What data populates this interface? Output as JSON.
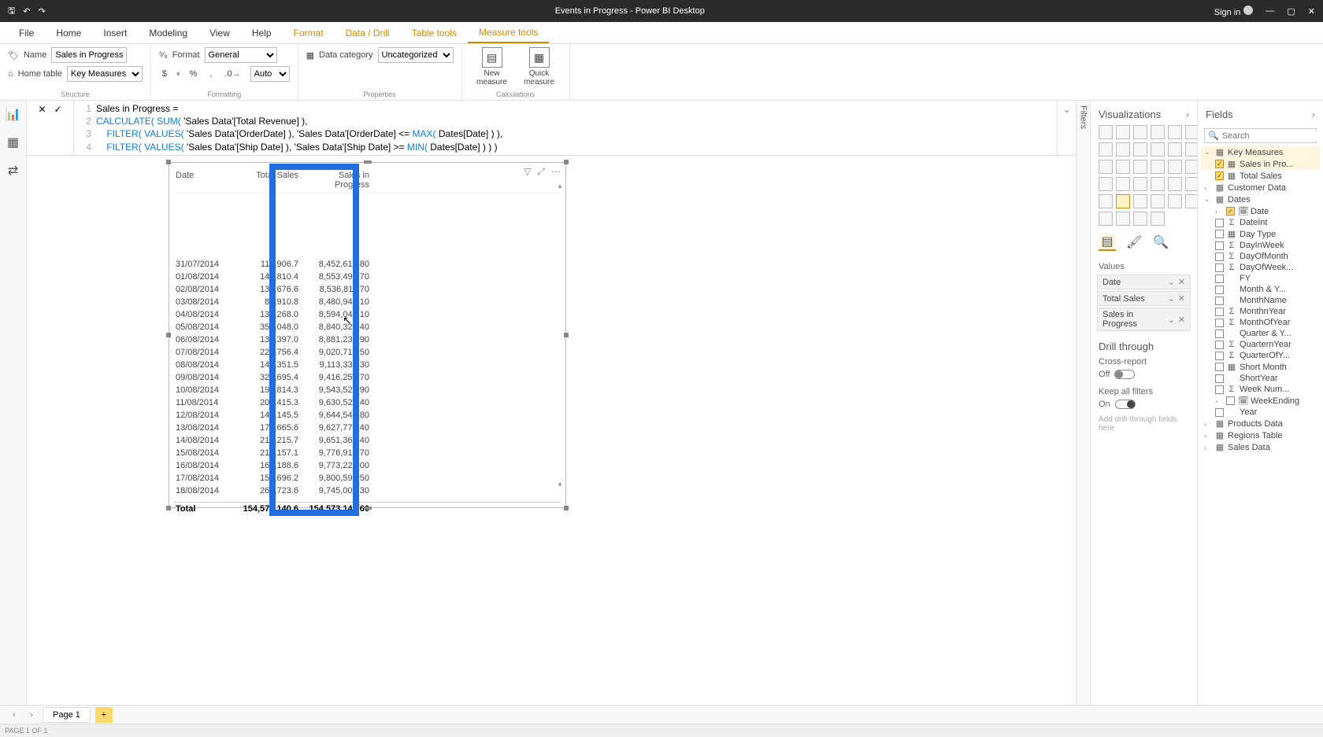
{
  "titlebar": {
    "title": "Events in Progress - Power BI Desktop",
    "signin": "Sign in"
  },
  "ribbon_tabs": {
    "file": "File",
    "home": "Home",
    "insert": "Insert",
    "modeling": "Modeling",
    "view": "View",
    "help": "Help",
    "format": "Format",
    "data_drill": "Data / Drill",
    "table_tools": "Table tools",
    "measure_tools": "Measure tools"
  },
  "ribbon": {
    "structure": {
      "label": "Structure",
      "name_label": "Name",
      "name_value": "Sales in Progress",
      "home_table_label": "Home table",
      "home_table_value": "Key Measures"
    },
    "formatting": {
      "label": "Formatting",
      "format_label": "Format",
      "format_value": "General",
      "currency": "$",
      "percent": "%",
      "comma": ",",
      "dec_label": "Auto"
    },
    "properties": {
      "label": "Properties",
      "data_category_label": "Data category",
      "data_category_value": "Uncategorized"
    },
    "calculations": {
      "label": "Calculations",
      "new_measure": "New measure",
      "quick_measure": "Quick measure"
    }
  },
  "formula": {
    "l1": "Sales in Progress =",
    "l2a": "CALCULATE( ",
    "l2b": "SUM( ",
    "l2c": "'Sales Data'[Total Revenue] ),",
    "l3a": "    FILTER( ",
    "l3b": "VALUES( ",
    "l3c": "'Sales Data'[OrderDate] ), 'Sales Data'[OrderDate] <= ",
    "l3d": "MAX( ",
    "l3e": "Dates[Date] ) ),",
    "l4a": "    FILTER( ",
    "l4b": "VALUES( ",
    "l4c": "'Sales Data'[Ship Date] ), 'Sales Data'[Ship Date] >= ",
    "l4d": "MIN( ",
    "l4e": "Dates[Date] ) ) )"
  },
  "table": {
    "headers": {
      "date": "Date",
      "total_sales": "Total Sales",
      "sip": "Sales in Progress"
    },
    "rows": [
      {
        "d": "31/07/2014",
        "s": "113,906.7",
        "p": "8,452,612.80"
      },
      {
        "d": "01/08/2014",
        "s": "146,810.4",
        "p": "8,553,494.70"
      },
      {
        "d": "02/08/2014",
        "s": "138,676.6",
        "p": "8,536,811.70"
      },
      {
        "d": "03/08/2014",
        "s": "83,910.8",
        "p": "8,480,947.10"
      },
      {
        "d": "04/08/2014",
        "s": "134,268.0",
        "p": "8,594,043.10"
      },
      {
        "d": "05/08/2014",
        "s": "358,048.0",
        "p": "8,840,328.40"
      },
      {
        "d": "06/08/2014",
        "s": "133,397.0",
        "p": "8,881,231.90"
      },
      {
        "d": "07/08/2014",
        "s": "229,756.4",
        "p": "9,020,712.50"
      },
      {
        "d": "08/08/2014",
        "s": "144,351.5",
        "p": "9,113,333.30"
      },
      {
        "d": "09/08/2014",
        "s": "324,695.4",
        "p": "9,416,253.70"
      },
      {
        "d": "10/08/2014",
        "s": "191,814.3",
        "p": "9,543,526.90"
      },
      {
        "d": "11/08/2014",
        "s": "205,415.3",
        "p": "9,630,526.40"
      },
      {
        "d": "12/08/2014",
        "s": "143,145.5",
        "p": "9,644,542.80"
      },
      {
        "d": "13/08/2014",
        "s": "176,665.6",
        "p": "9,627,779.40"
      },
      {
        "d": "14/08/2014",
        "s": "216,215.7",
        "p": "9,651,363.40"
      },
      {
        "d": "15/08/2014",
        "s": "215,157.1",
        "p": "9,776,914.70"
      },
      {
        "d": "16/08/2014",
        "s": "161,188.6",
        "p": "9,773,223.00"
      },
      {
        "d": "17/08/2014",
        "s": "158,696.2",
        "p": "9,800,592.50"
      },
      {
        "d": "18/08/2014",
        "s": "268,723.6",
        "p": "9,745,009.30"
      }
    ],
    "footer": {
      "label": "Total",
      "s": "154,573,140.6",
      "p": "154,573,140.60"
    }
  },
  "filters_label": "Filters",
  "viz": {
    "title": "Visualizations",
    "values_label": "Values",
    "wells": [
      {
        "name": "Date"
      },
      {
        "name": "Total Sales"
      },
      {
        "name": "Sales in Progress"
      }
    ],
    "drill_title": "Drill through",
    "cross_report": "Cross-report",
    "off": "Off",
    "keep_filters": "Keep all filters",
    "on": "On",
    "drill_placeholder": "Add drill-through fields here"
  },
  "fields": {
    "title": "Fields",
    "search_placeholder": "Search",
    "tables": {
      "key_measures": "Key Measures",
      "sales_in_pro": "Sales in Pro...",
      "total_sales": "Total Sales",
      "customer_data": "Customer Data",
      "dates": "Dates",
      "date": "Date",
      "dateint": "DateInt",
      "day_type": "Day Type",
      "dayinweek": "DayInWeek",
      "dayofmonth": "DayOfMonth",
      "dayofweek": "DayOfWeek...",
      "fy": "FY",
      "month_y": "Month & Y...",
      "monthname": "MonthName",
      "monthnyear": "MonthnYear",
      "monthofyear": "MonthOfYear",
      "quarter_y": "Quarter & Y...",
      "quarternyear": "QuarternYear",
      "quarterofy": "QuarterOfY...",
      "short_month": "Short Month",
      "shortyear": "ShortYear",
      "week_num": "Week Num...",
      "weekending": "WeekEnding",
      "year": "Year",
      "products_data": "Products Data",
      "regions_table": "Regions Table",
      "sales_data": "Sales Data"
    }
  },
  "page_tabs": {
    "page1": "Page 1",
    "add": "+"
  },
  "status": "PAGE 1 OF 1"
}
